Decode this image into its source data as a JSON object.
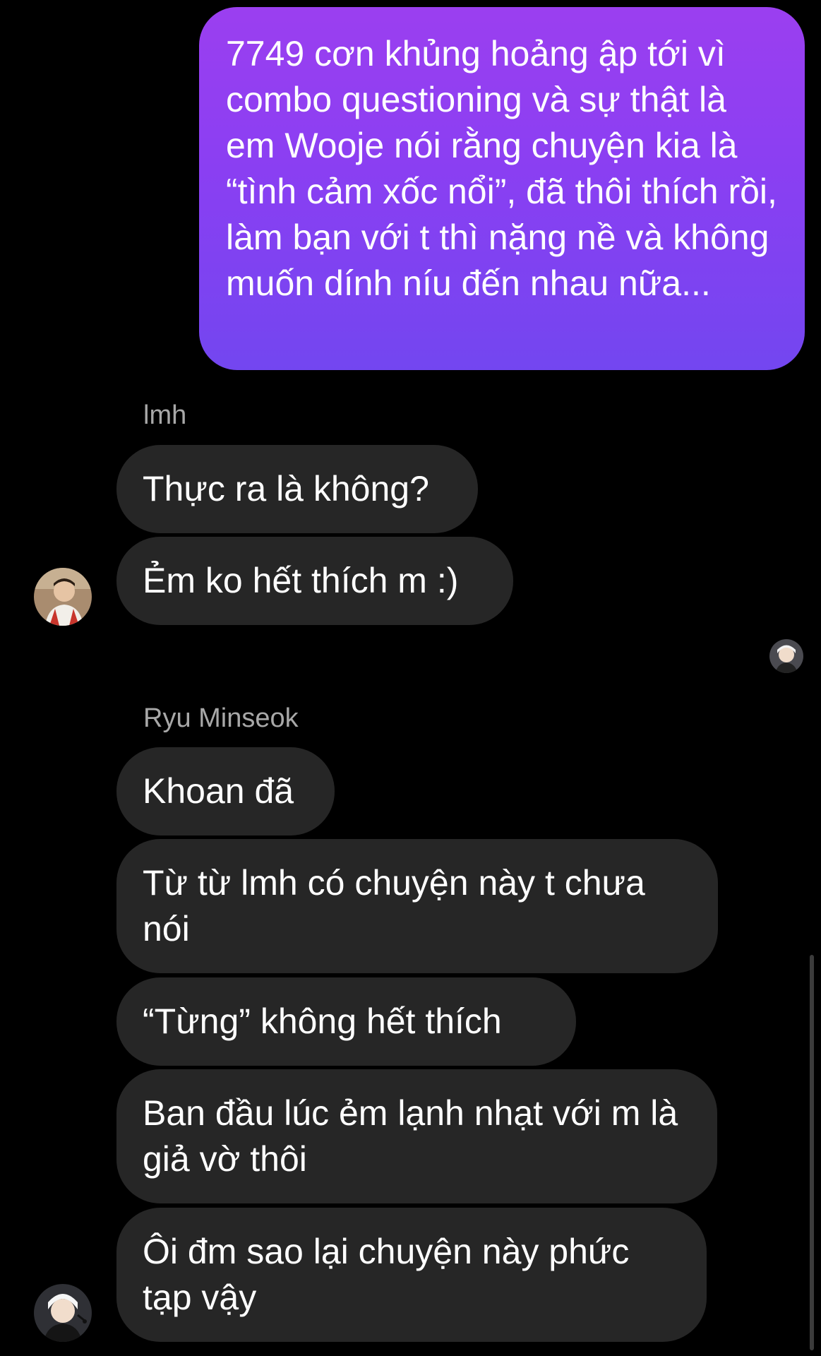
{
  "messages": {
    "outgoing_1": "7749 cơn khủng hoảng ập tới vì combo questioning và sự thật là em Wooje nói rằng chuyện kia là “tình cảm xốc nổi”, đã thôi thích rồi, làm bạn với t thì nặng nề và không muốn dính níu đến nhau nữa...",
    "lmh_sender": "lmh",
    "lmh_1": "Thực ra là không?",
    "lmh_2": "Ẻm ko hết thích m :)",
    "ryu_sender": "Ryu Minseok",
    "ryu_1": "Khoan đã",
    "ryu_2": "Từ từ lmh có chuyện này t chưa nói",
    "ryu_3": "“Từng” không hết thích",
    "ryu_4": "Ban đầu lúc ẻm lạnh nhạt với m là giả vờ thôi",
    "ryu_5": "Ôi đm sao lại chuyện này phức tạp vậy"
  },
  "colors": {
    "background": "#000000",
    "outgoing_bubble_top": "#9b3ff0",
    "outgoing_bubble_bottom": "#7346f0",
    "incoming_bubble": "#262626",
    "sender_name": "#a8a8a8"
  },
  "icons": {
    "lmh_avatar": "avatar-photo-lmh",
    "seen_avatar": "avatar-photo-seen",
    "ryu_avatar": "avatar-photo-ryu"
  }
}
